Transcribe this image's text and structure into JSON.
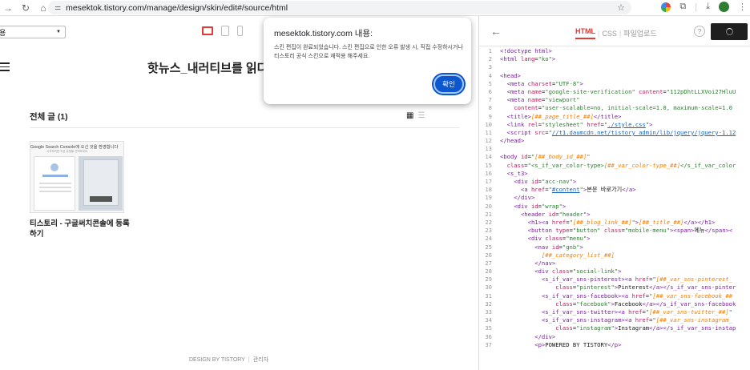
{
  "browser": {
    "url": "mesektok.tistory.com/manage/design/skin/edit#/source/html"
  },
  "preview": {
    "select_value": "용",
    "blog_title": "핫뉴스_내러티브를 읽다, 세",
    "list_title": "전체 글 (1)",
    "thumb_caption": "Google Search Console에 오신 것을 환영합니다",
    "thumb_sub": "시작하려면 속성 유형을 선택하세요",
    "post_title": "티스토리 - 구글써치콘솔에 등록하기",
    "footer_design": "DESIGN BY TISTORY",
    "footer_admin": "관리자"
  },
  "dialog": {
    "title": "mesektok.tistory.com 내용:",
    "message": "스킨 편집이 완료되었습니다. 스킨 편집으로 인한 오류 발생 시, 직접 수정하시거나 티스토리 공식 스킨으로 재적용 해주세요.",
    "confirm_label": "확인"
  },
  "editor": {
    "tab_html": "HTML",
    "tab_css": "CSS",
    "tab_upload": "파일업로드",
    "help_label": "?",
    "lines": [
      {
        "n": "1",
        "html": "<span class='tg'>&lt;!doctype html&gt;</span>"
      },
      {
        "n": "2",
        "html": "<span class='tg'>&lt;html</span> <span class='at'>lang</span>=<span class='st'>\"ko\"</span><span class='tg'>&gt;</span>"
      },
      {
        "n": "3",
        "html": ""
      },
      {
        "n": "4",
        "html": "<span class='tg'>&lt;head&gt;</span>"
      },
      {
        "n": "5",
        "html": "  <span class='tg'>&lt;meta</span> <span class='at'>charset</span>=<span class='st'>\"UTF-8\"</span><span class='tg'>&gt;</span>"
      },
      {
        "n": "6",
        "html": "  <span class='tg'>&lt;meta</span> <span class='at'>name</span>=<span class='st'>\"google-site-verification\"</span> <span class='at'>content</span>=<span class='st'>\"112pDhtLLXVoi27HluU</span>"
      },
      {
        "n": "7",
        "html": "  <span class='tg'>&lt;meta</span> <span class='at'>name</span>=<span class='st'>\"viewport\"</span>"
      },
      {
        "n": "8",
        "html": "    <span class='at'>content</span>=<span class='st'>\"user-scalable=no, initial-scale=1.0, maximum-scale=1.0</span>"
      },
      {
        "n": "9",
        "html": "  <span class='tg'>&lt;title&gt;</span><span class='vr'>[##_page_title_##]</span><span class='tg'>&lt;/title&gt;</span>"
      },
      {
        "n": "10",
        "html": "  <span class='tg'>&lt;link</span> <span class='at'>rel</span>=<span class='st'>\"stylesheet\"</span> <span class='at'>href</span>=<span class='st'>\"<span class='lk'>./style.css</span>\"</span><span class='tg'>&gt;</span>"
      },
      {
        "n": "11",
        "html": "  <span class='tg'>&lt;script</span> <span class='at'>src</span>=<span class='st'>\"<span class='lk'>//t1.daumcdn.net/tistory_admin/lib/jquery/jquery-1.12</span></span>"
      },
      {
        "n": "12",
        "html": "<span class='tg'>&lt;/head&gt;</span>"
      },
      {
        "n": "13",
        "html": ""
      },
      {
        "n": "14",
        "html": "<span class='tg'>&lt;body</span> <span class='at'>id</span>=<span class='st'>\"<span class='vr'>[##_body_id_##]</span>\"</span>"
      },
      {
        "n": "15",
        "html": "  <span class='at'>class</span>=<span class='st'>\"&lt;s_if_var_color-type&gt;<span class='vr'>[##_var_color-type_##]</span>&lt;/s_if_var_color</span>"
      },
      {
        "n": "16",
        "html": "  <span class='tg'>&lt;s_t3&gt;</span>"
      },
      {
        "n": "17",
        "html": "    <span class='tg'>&lt;div</span> <span class='at'>id</span>=<span class='st'>\"acc-nav\"</span><span class='tg'>&gt;</span>"
      },
      {
        "n": "18",
        "html": "      <span class='tg'>&lt;a</span> <span class='at'>href</span>=<span class='st'>\"<span class='lk'>#content</span>\"</span><span class='tg'>&gt;</span>본문 바로가기<span class='tg'>&lt;/a&gt;</span>"
      },
      {
        "n": "19",
        "html": "    <span class='tg'>&lt;/div&gt;</span>"
      },
      {
        "n": "20",
        "html": "    <span class='tg'>&lt;div</span> <span class='at'>id</span>=<span class='st'>\"wrap\"</span><span class='tg'>&gt;</span>"
      },
      {
        "n": "21",
        "html": "      <span class='tg'>&lt;header</span> <span class='at'>id</span>=<span class='st'>\"header\"</span><span class='tg'>&gt;</span>"
      },
      {
        "n": "22",
        "html": "        <span class='tg'>&lt;h1&gt;&lt;a</span> <span class='at'>href</span>=<span class='st'>\"<span class='vr'>[##_blog_link_##]</span>\"</span><span class='tg'>&gt;</span><span class='vr'>[##_title_##]</span><span class='tg'>&lt;/a&gt;&lt;/h1&gt;</span>"
      },
      {
        "n": "23",
        "html": "        <span class='tg'>&lt;button</span> <span class='at'>type</span>=<span class='st'>\"button\"</span> <span class='at'>class</span>=<span class='st'>\"mobile-menu\"</span><span class='tg'>&gt;&lt;span&gt;</span>메뉴<span class='tg'>&lt;/span&gt;&lt;</span>"
      },
      {
        "n": "24",
        "html": "        <span class='tg'>&lt;div</span> <span class='at'>class</span>=<span class='st'>\"menu\"</span><span class='tg'>&gt;</span>"
      },
      {
        "n": "25",
        "html": "          <span class='tg'>&lt;nav</span> <span class='at'>id</span>=<span class='st'>\"gnb\"</span><span class='tg'>&gt;</span>"
      },
      {
        "n": "26",
        "html": "            <span class='vr'>[##_category_list_##]</span>"
      },
      {
        "n": "27",
        "html": "          <span class='tg'>&lt;/nav&gt;</span>"
      },
      {
        "n": "28",
        "html": "          <span class='tg'>&lt;div</span> <span class='at'>class</span>=<span class='st'>\"social-link\"</span><span class='tg'>&gt;</span>"
      },
      {
        "n": "29",
        "html": "            <span class='tg'>&lt;s_if_var_sns-pinterest&gt;&lt;a</span> <span class='at'>href</span>=<span class='st'>\"<span class='vr'>[##_var_sns-pinterest_</span></span>"
      },
      {
        "n": "30",
        "html": "                <span class='at'>class</span>=<span class='st'>\"pinterest\"</span><span class='tg'>&gt;</span>Pinterest<span class='tg'>&lt;/a&gt;&lt;/s_if_var_sns-pinter</span>"
      },
      {
        "n": "31",
        "html": "            <span class='tg'>&lt;s_if_var_sns-facebook&gt;&lt;a</span> <span class='at'>href</span>=<span class='st'>\"<span class='vr'>[##_var_sns-facebook_##</span></span>"
      },
      {
        "n": "32",
        "html": "                <span class='at'>class</span>=<span class='st'>\"facebook\"</span><span class='tg'>&gt;</span>Facebook<span class='tg'>&lt;/a&gt;&lt;/s_if_var_sns-facebook</span>"
      },
      {
        "n": "33",
        "html": "            <span class='tg'>&lt;s_if_var_sns-twitter&gt;&lt;a</span> <span class='at'>href</span>=<span class='st'>\"<span class='vr'>[##_var_sns-twitter_##]</span>\"</span>"
      },
      {
        "n": "34",
        "html": "            <span class='tg'>&lt;s_if_var_sns-instagram&gt;&lt;a</span> <span class='at'>href</span>=<span class='st'>\"<span class='vr'>[##_var_sns-instagram_</span></span>"
      },
      {
        "n": "35",
        "html": "                <span class='at'>class</span>=<span class='st'>\"instagram\"</span><span class='tg'>&gt;</span>Instagram<span class='tg'>&lt;/a&gt;&lt;/s_if_var_sns-instap</span>"
      },
      {
        "n": "36",
        "html": "          <span class='tg'>&lt;/div&gt;</span>"
      },
      {
        "n": "37",
        "html": "          <span class='tg'>&lt;p&gt;</span>POWERED BY TISTORY<span class='tg'>&lt;/p&gt;</span>"
      }
    ]
  }
}
